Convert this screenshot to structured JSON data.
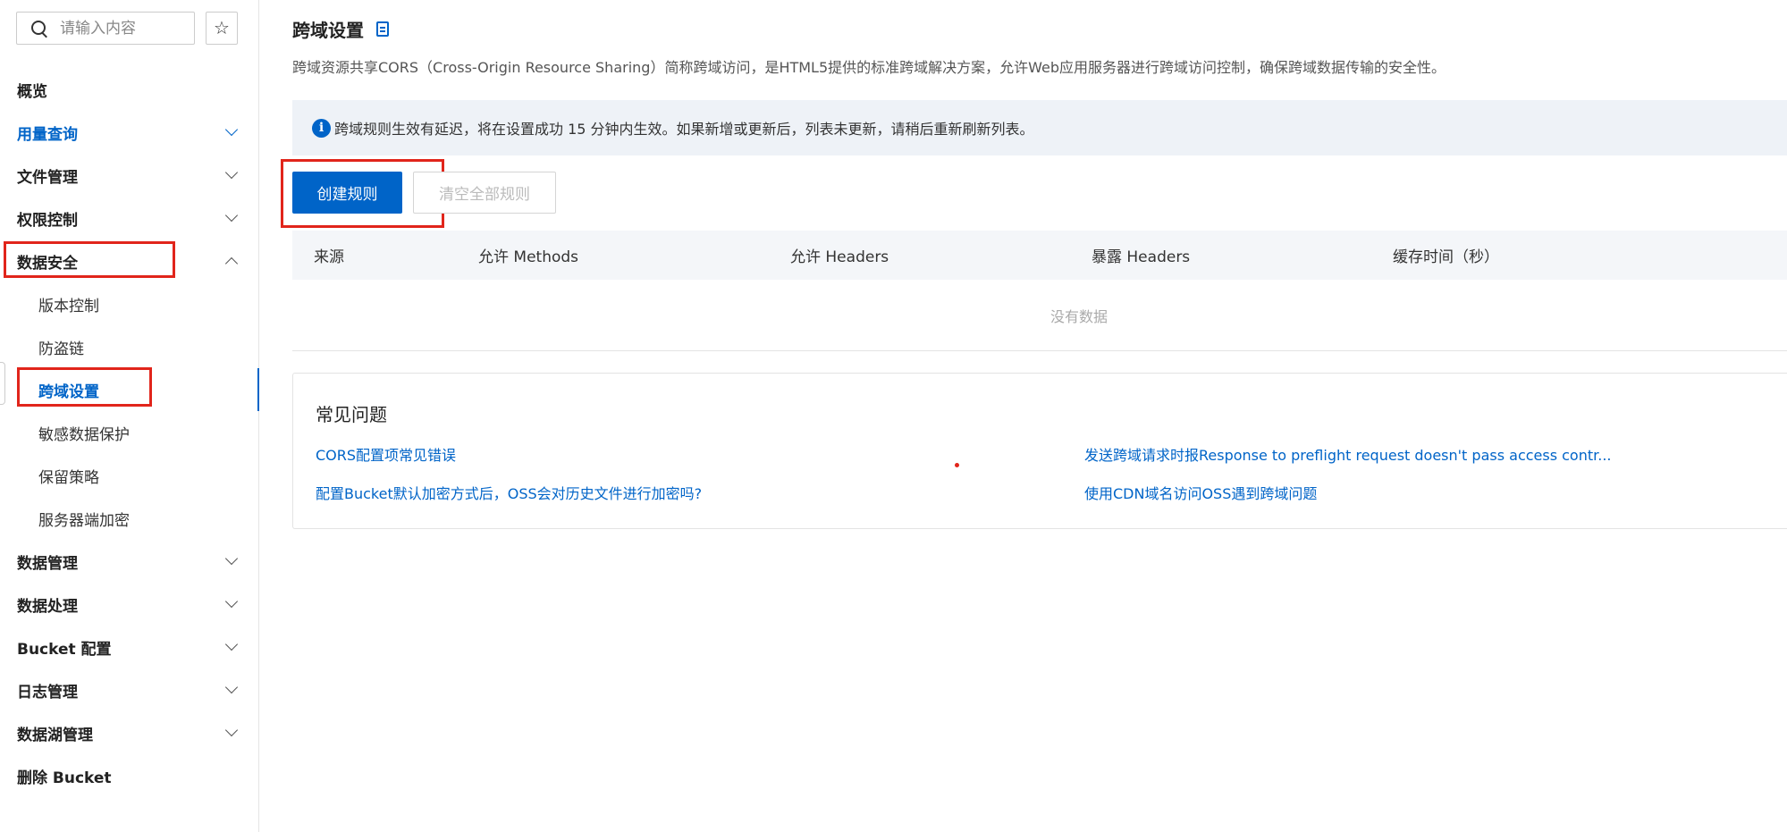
{
  "sidebar": {
    "search_placeholder": "请输入内容",
    "items": [
      {
        "label": "概览"
      },
      {
        "label": "用量查询"
      },
      {
        "label": "文件管理"
      },
      {
        "label": "权限控制"
      },
      {
        "label": "数据安全"
      },
      {
        "label": "数据管理"
      },
      {
        "label": "数据处理"
      },
      {
        "label": "Bucket 配置"
      },
      {
        "label": "日志管理"
      },
      {
        "label": "数据湖管理"
      },
      {
        "label": "删除 Bucket"
      }
    ],
    "data_security_sub": [
      {
        "label": "版本控制"
      },
      {
        "label": "防盗链"
      },
      {
        "label": "跨域设置"
      },
      {
        "label": "敏感数据保护"
      },
      {
        "label": "保留策略"
      },
      {
        "label": "服务器端加密"
      }
    ]
  },
  "main": {
    "title": "跨域设置",
    "description": "跨域资源共享CORS（Cross-Origin Resource Sharing）简称跨域访问，是HTML5提供的标准跨域解决方案，允许Web应用服务器进行跨域访问控制，确保跨域数据传输的安全性。",
    "notice": "跨域规则生效有延迟，将在设置成功 15 分钟内生效。如果新增或更新后，列表未更新，请稍后重新刷新列表。",
    "create_button": "创建规则",
    "clear_button": "清空全部规则",
    "table": {
      "columns": [
        "来源",
        "允许 Methods",
        "允许 Headers",
        "暴露 Headers",
        "缓存时间（秒）"
      ],
      "empty_text": "没有数据"
    },
    "faq": {
      "title": "常见问题",
      "links": [
        "CORS配置项常见错误",
        "发送跨域请求时报Response to preflight request doesn't pass access contr...",
        "配置Bucket默认加密方式后，OSS会对历史文件进行加密吗?",
        "使用CDN域名访问OSS遇到跨域问题"
      ]
    }
  },
  "colors": {
    "accent": "#0064c8",
    "highlight_box": "#e1251b"
  }
}
